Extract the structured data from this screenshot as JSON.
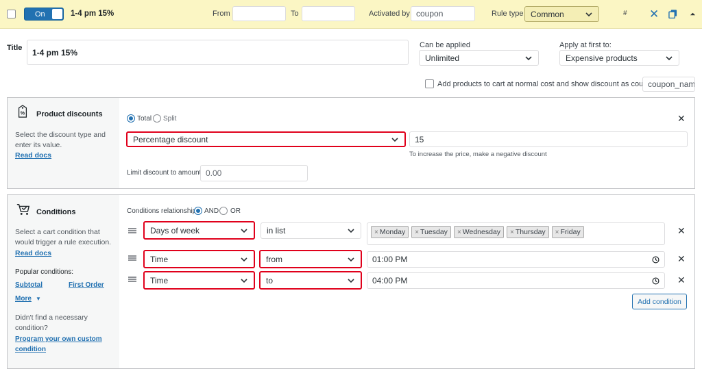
{
  "header": {
    "toggle_label": "On",
    "rule_title": "1-4 pm 15%",
    "from_label": "From",
    "to_label": "To",
    "activated_by_label": "Activated by",
    "activated_by_value": "coupon",
    "rule_type_label": "Rule type",
    "rule_type_value": "Common",
    "hash_label": "#",
    "bg_color": "#fbf6c4"
  },
  "rule": {
    "title_label": "Title",
    "title_value": "1-4 pm 15%",
    "can_be_applied_label": "Can be applied",
    "can_be_applied_value": "Unlimited",
    "apply_first_label": "Apply at first to:",
    "apply_first_value": "Expensive products",
    "add_products_label": "Add products to cart at normal cost and show discount as coupon",
    "coupon_name_placeholder": "coupon_name"
  },
  "product_discounts": {
    "heading": "Product discounts",
    "description": "Select the discount type and enter its value.",
    "read_docs": "Read docs",
    "total_label": "Total",
    "split_label": "Split",
    "discount_type": "Percentage discount",
    "discount_value": "15",
    "hint": "To increase the price, make a negative discount",
    "limit_label": "Limit discount to amount:",
    "limit_placeholder": "0.00"
  },
  "conditions": {
    "heading": "Conditions",
    "description": "Select a cart condition that would trigger a rule execution.",
    "read_docs": "Read docs",
    "popular_label": "Popular conditions:",
    "popular_subtotal": "Subtotal",
    "popular_first_order": "First Order",
    "more_label": "More",
    "not_found_text": "Didn't find a necessary condition?",
    "program_link": "Program your own custom condition",
    "relationship_label": "Conditions relationship",
    "and_label": "AND",
    "or_label": "OR",
    "add_condition": "Add condition",
    "rows": [
      {
        "type": "Days of week",
        "operator": "in list",
        "tags": [
          "Monday",
          "Tuesday",
          "Wednesday",
          "Thursday",
          "Friday"
        ]
      },
      {
        "type": "Time",
        "operator": "from",
        "value": "01:00 PM"
      },
      {
        "type": "Time",
        "operator": "to",
        "value": "04:00 PM"
      }
    ]
  },
  "colors": {
    "accent": "#2271b1",
    "highlight": "#e0001b",
    "panel_bg": "#f6f7f7"
  },
  "icons": [
    "checkbox-icon",
    "close-icon",
    "copy-icon",
    "caret-up-icon",
    "chevron-down-icon",
    "percent-tag-icon",
    "cart-conditions-icon",
    "drag-handle-icon",
    "clock-icon"
  ]
}
